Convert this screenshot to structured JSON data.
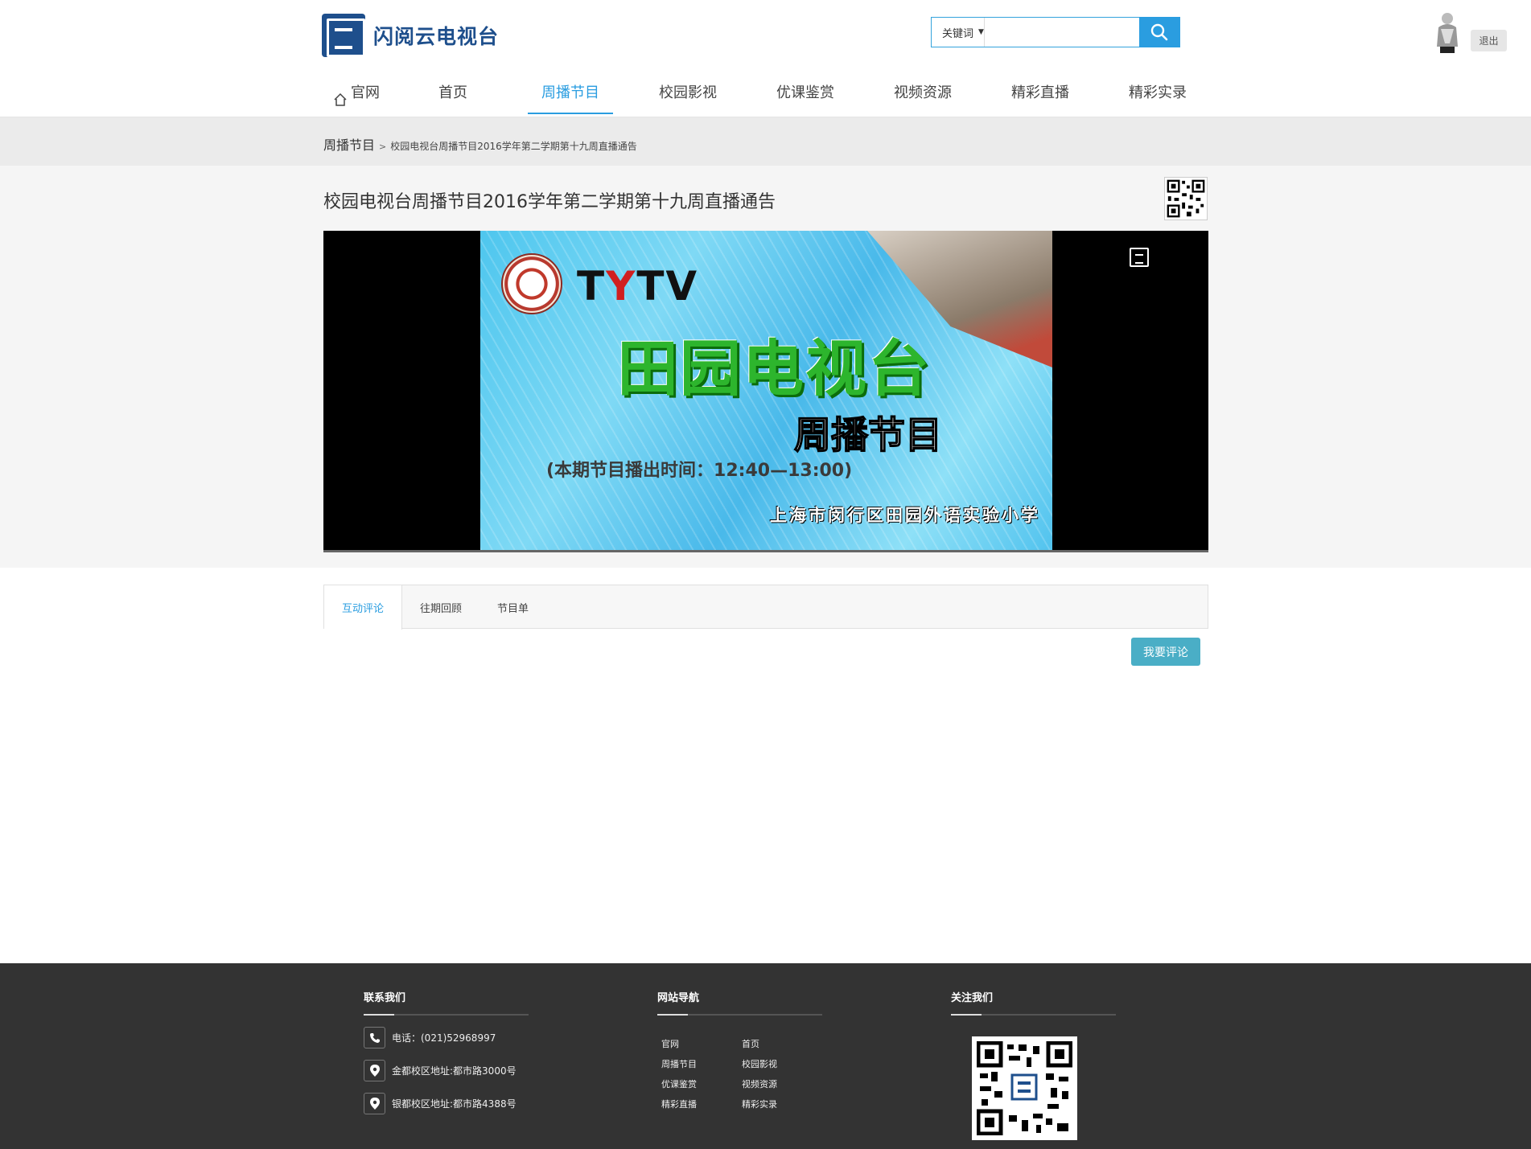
{
  "site": {
    "logo_text": "闪阅云电视台"
  },
  "search": {
    "select_label": "关键词",
    "placeholder": ""
  },
  "user": {
    "logout_label": "退出"
  },
  "nav": [
    {
      "label": "官网"
    },
    {
      "label": "首页"
    },
    {
      "label": "周播节目"
    },
    {
      "label": "校园影视"
    },
    {
      "label": "优课鉴赏"
    },
    {
      "label": "视频资源"
    },
    {
      "label": "精彩直播"
    },
    {
      "label": "精彩实录"
    }
  ],
  "breadcrumb": {
    "root": "周播节目",
    "sep": ">",
    "current": "校园电视台周播节目2016学年第二学期第十九周直播通告"
  },
  "video": {
    "title": "校园电视台周播节目2016学年第二学期第十九周直播通告",
    "frame_brand_a": "T",
    "frame_brand_b": "Y",
    "frame_brand_c": "TV",
    "frame_big": "田园电视台",
    "frame_sub": "周播节目",
    "frame_time": "(本期节目播出时间：12:40—13:00)",
    "frame_school": "上海市闵行区田园外语实验小学"
  },
  "tabs": [
    {
      "label": "互动评论"
    },
    {
      "label": "往期回顾"
    },
    {
      "label": "节目单"
    }
  ],
  "comment_button": "我要评论",
  "footer": {
    "contact_title": "联系我们",
    "phone": "电话：(021)52968997",
    "addr1": "金都校区地址:都市路3000号",
    "addr2": "银都校区地址:都市路4388号",
    "nav_title": "网站导航",
    "nav_links": [
      "官网",
      "首页",
      "周播节目",
      "校园影视",
      "优课鉴赏",
      "视频资源",
      "精彩直播",
      "精彩实录"
    ],
    "follow_title": "关注我们"
  },
  "colors": {
    "accent": "#2a9de0",
    "brand": "#1e4f8c",
    "footer_bg": "#333333",
    "comment_btn": "#4aaec6"
  }
}
